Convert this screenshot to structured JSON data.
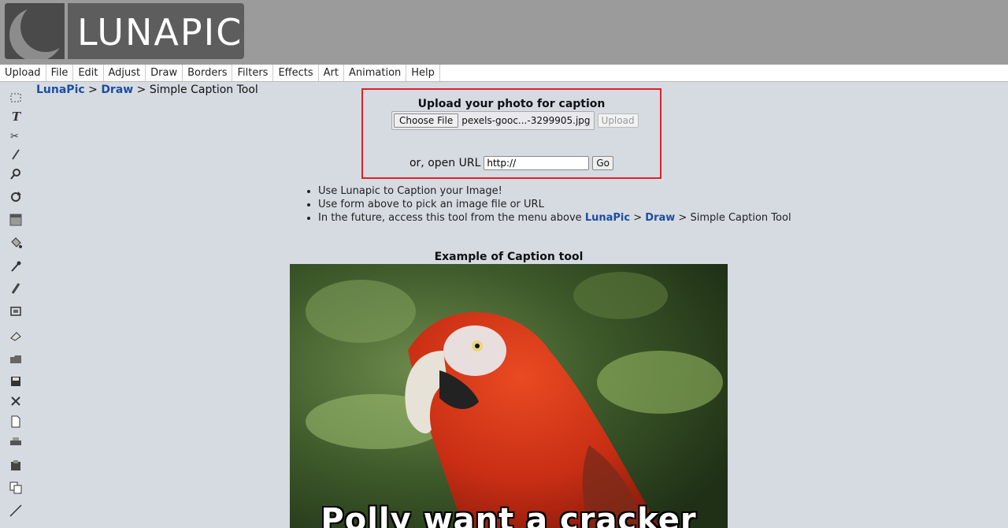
{
  "header": {
    "logo_text": "LUNAPIC"
  },
  "menu": [
    {
      "label": "Upload"
    },
    {
      "label": "File"
    },
    {
      "label": "Edit"
    },
    {
      "label": "Adjust"
    },
    {
      "label": "Draw"
    },
    {
      "label": "Borders"
    },
    {
      "label": "Filters"
    },
    {
      "label": "Effects"
    },
    {
      "label": "Art"
    },
    {
      "label": "Animation"
    },
    {
      "label": "Help"
    }
  ],
  "toolbar": {
    "tools": [
      "select-icon",
      "text-tool-icon",
      "scissors-icon",
      "pencil-icon",
      "magnifier-icon",
      "rotate-icon",
      "gradient-icon",
      "paint-bucket-icon",
      "eyedropper-icon",
      "brush-icon",
      "crop-icon",
      "eraser-icon",
      "open-folder-icon",
      "save-icon",
      "close-icon",
      "new-file-icon",
      "print-icon",
      "clipboard-icon",
      "copy-icon",
      "line-icon"
    ]
  },
  "breadcrumb": {
    "home": "LunaPic",
    "sep1": ">",
    "section": "Draw",
    "sep2": ">",
    "current": "Simple Caption Tool"
  },
  "upload": {
    "title": "Upload your photo for caption",
    "choose_label": "Choose File",
    "file_name": "pexels-gooc...-3299905.jpg",
    "upload_label": "Upload",
    "url_label": "or, open URL",
    "url_value": "http://",
    "go_label": "Go"
  },
  "info": {
    "bullet1": "Use Lunapic to Caption your Image!",
    "bullet2": "Use form above to pick an image file or URL",
    "bullet3_prefix": "In the future, access this tool from the menu above",
    "bullet3_link1": "LunaPic",
    "bullet3_sep1": ">",
    "bullet3_link2": "Draw",
    "bullet3_sep2": ">",
    "bullet3_suffix": "Simple Caption Tool"
  },
  "example": {
    "title": "Example of Caption tool",
    "caption": "Polly want a cracker"
  },
  "colors": {
    "header_bg": "#9b9b9b",
    "page_bg": "#d6dbe2",
    "link": "#1c4ea0",
    "highlight_border": "#e0202a"
  }
}
